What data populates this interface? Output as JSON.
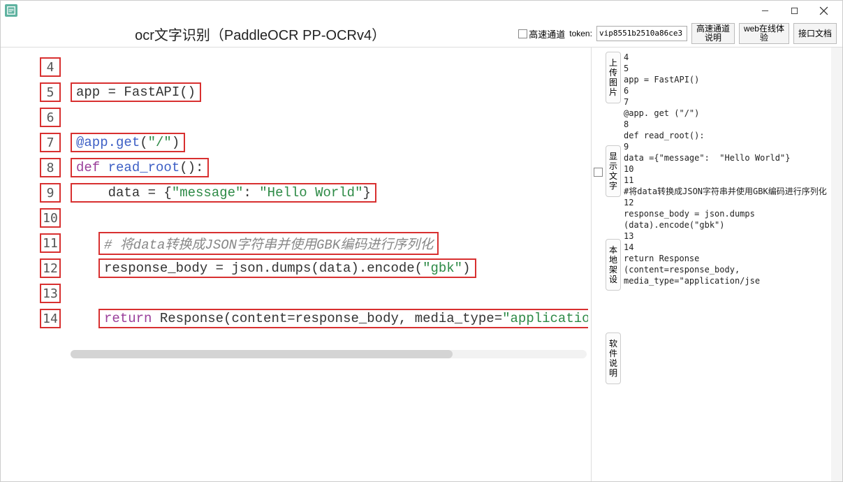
{
  "titlebar": {
    "app_name": ""
  },
  "header": {
    "title": "ocr文字识别（PaddleOCR PP-OCRv4）",
    "highspeed_label": "高速通道",
    "token_label": "token:",
    "token_value": "vip8551b2510a86ce3",
    "btn_highspeed_help": "高速通道\n说明",
    "btn_webcheck": "web在线体\n验",
    "btn_apidoc": "接口文档"
  },
  "code": {
    "lines": [
      {
        "num": "4",
        "boxed": false,
        "indent": 0,
        "segments": []
      },
      {
        "num": "5",
        "boxed": true,
        "indent": 0,
        "segments": [
          {
            "t": "app = ",
            "c": "id"
          },
          {
            "t": "FastAPI()",
            "c": "id"
          }
        ]
      },
      {
        "num": "6",
        "boxed": false,
        "indent": 0,
        "segments": []
      },
      {
        "num": "7",
        "boxed": true,
        "indent": 0,
        "segments": [
          {
            "t": "@app.get",
            "c": "dec"
          },
          {
            "t": "(",
            "c": "id"
          },
          {
            "t": "\"/\"",
            "c": "str"
          },
          {
            "t": ")",
            "c": "id"
          }
        ]
      },
      {
        "num": "8",
        "boxed": true,
        "indent": 0,
        "segments": [
          {
            "t": "def ",
            "c": "kw"
          },
          {
            "t": "read_root",
            "c": "fn"
          },
          {
            "t": "():",
            "c": "id"
          }
        ]
      },
      {
        "num": "9",
        "boxed": true,
        "indent": 0,
        "segments": [
          {
            "t": "    data = {",
            "c": "id"
          },
          {
            "t": "\"message\"",
            "c": "str"
          },
          {
            "t": ": ",
            "c": "id"
          },
          {
            "t": "\"Hello World\"",
            "c": "str"
          },
          {
            "t": "}",
            "c": "id"
          }
        ]
      },
      {
        "num": "10",
        "boxed": false,
        "indent": 0,
        "segments": []
      },
      {
        "num": "11",
        "boxed": true,
        "indent": 2,
        "segments": [
          {
            "t": "# 将data转换成JSON字符串并使用GBK编码进行序列化",
            "c": "cm"
          }
        ]
      },
      {
        "num": "12",
        "boxed": true,
        "indent": 2,
        "segments": [
          {
            "t": "response_body = json.dumps(data).encode(",
            "c": "id"
          },
          {
            "t": "\"gbk\"",
            "c": "str"
          },
          {
            "t": ")",
            "c": "id"
          }
        ]
      },
      {
        "num": "13",
        "boxed": false,
        "indent": 0,
        "segments": []
      },
      {
        "num": "14",
        "boxed": true,
        "indent": 2,
        "segments": [
          {
            "t": "return ",
            "c": "kw"
          },
          {
            "t": "Response(content=response_body, media_type=",
            "c": "id"
          },
          {
            "t": "\"applicatio",
            "c": "str"
          }
        ]
      }
    ]
  },
  "sidebar": {
    "btn_upload": "上传图片",
    "btn_showtext": "显示文字",
    "btn_local": "本地架设",
    "btn_help": "软件说明"
  },
  "output": {
    "text": "4\n5\napp = FastAPI()\n6\n7\n@app. get (\"/\")\n8\ndef read_root():\n9\ndata ={\"message\":  \"Hello World\"}\n10\n11\n#将data转换成JSON字符串并使用GBK编码进行序列化\n12\nresponse_body = json.dumps\n(data).encode(\"gbk\")\n13\n14\nreturn Response\n(content=response_body,\nmedia_type=\"application/jse"
  }
}
